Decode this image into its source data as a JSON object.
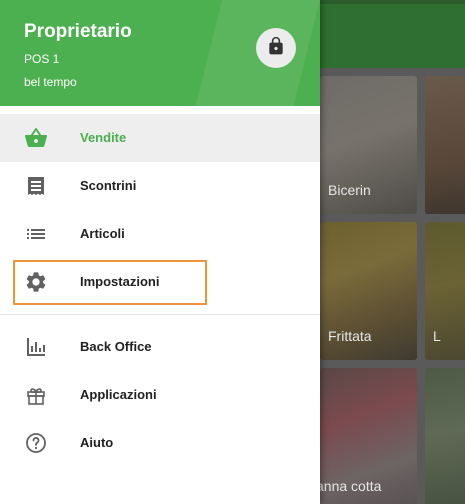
{
  "drawer": {
    "owner": "Proprietario",
    "pos": "POS 1",
    "store": "bel tempo",
    "lock_icon": "lock-icon"
  },
  "menu": {
    "primary": [
      {
        "id": "vendite",
        "label": "Vendite",
        "icon": "basket-icon",
        "active": true
      },
      {
        "id": "scontrini",
        "label": "Scontrini",
        "icon": "receipt-icon",
        "active": false
      },
      {
        "id": "articoli",
        "label": "Articoli",
        "icon": "list-icon",
        "active": false
      },
      {
        "id": "impostazioni",
        "label": "Impostazioni",
        "icon": "gear-icon",
        "active": false,
        "highlighted": true
      }
    ],
    "secondary": [
      {
        "id": "back-office",
        "label": "Back Office",
        "icon": "bar-chart-icon"
      },
      {
        "id": "applicazioni",
        "label": "Applicazioni",
        "icon": "gift-icon"
      },
      {
        "id": "aiuto",
        "label": "Aiuto",
        "icon": "help-icon"
      }
    ]
  },
  "background": {
    "items": [
      "Bicerin",
      "Frittata",
      "L",
      "anna cotta"
    ]
  },
  "colors": {
    "accent": "#4caf50",
    "highlight": "#f0923a",
    "topbar": "#2f6f31"
  }
}
